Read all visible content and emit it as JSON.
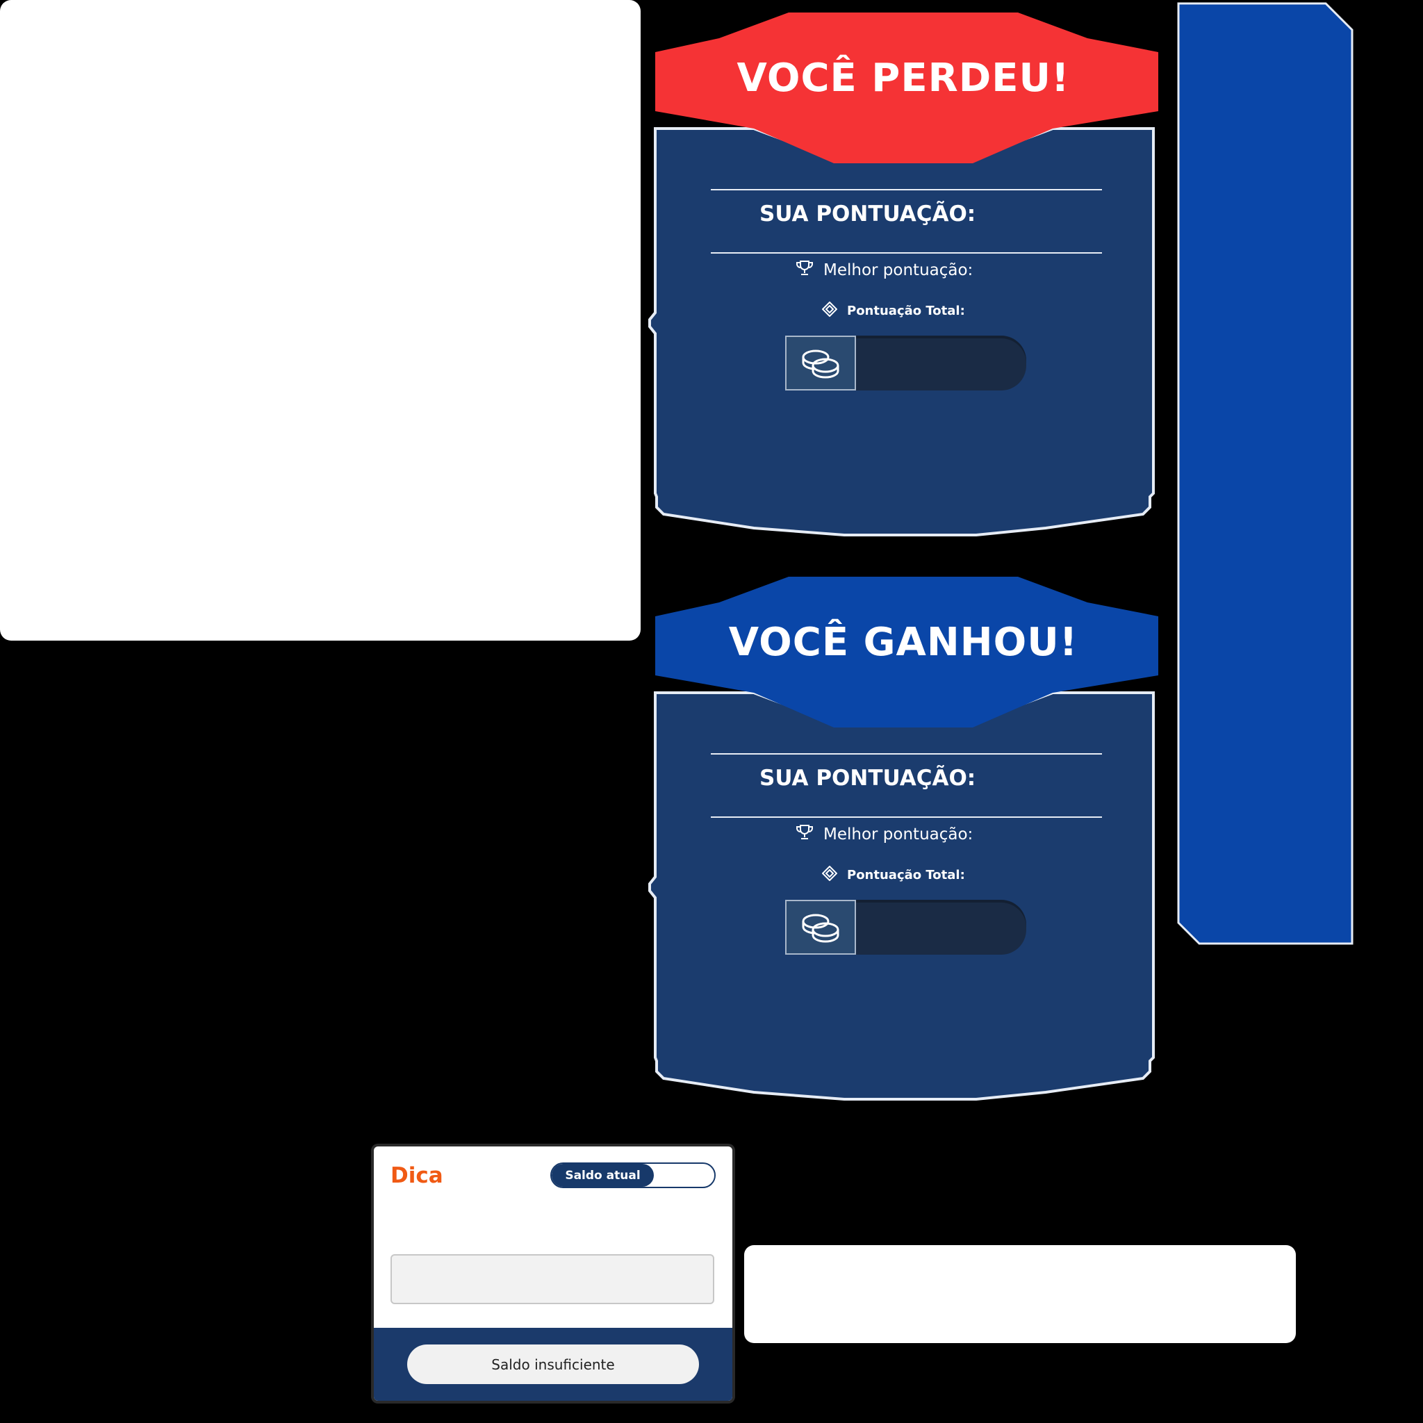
{
  "colors": {
    "lose_banner": "#f53335",
    "win_banner": "#0a46a8",
    "panel_body": "#1b3c6e",
    "side_panel": "#0a46a8",
    "hint_accent": "#f05a14",
    "footer": "#1b3a6b"
  },
  "lose_screen": {
    "title": "VOCÊ PERDEU!",
    "score_label": "SUA PONTUAÇÃO:",
    "best_label": "Melhor pontuação:",
    "total_label": "Pontuação Total:",
    "icons": [
      "trophy-icon",
      "gem-icon",
      "coins-icon"
    ]
  },
  "win_screen": {
    "title": "VOCÊ GANHOU!",
    "score_label": "SUA PONTUAÇÃO:",
    "best_label": "Melhor pontuação:",
    "total_label": "Pontuação Total:",
    "icons": [
      "trophy-icon",
      "gem-icon",
      "coins-icon"
    ]
  },
  "hint_card": {
    "title": "Dica",
    "balance_label": "Saldo atual",
    "button_label": "Saldo insuficiente"
  }
}
